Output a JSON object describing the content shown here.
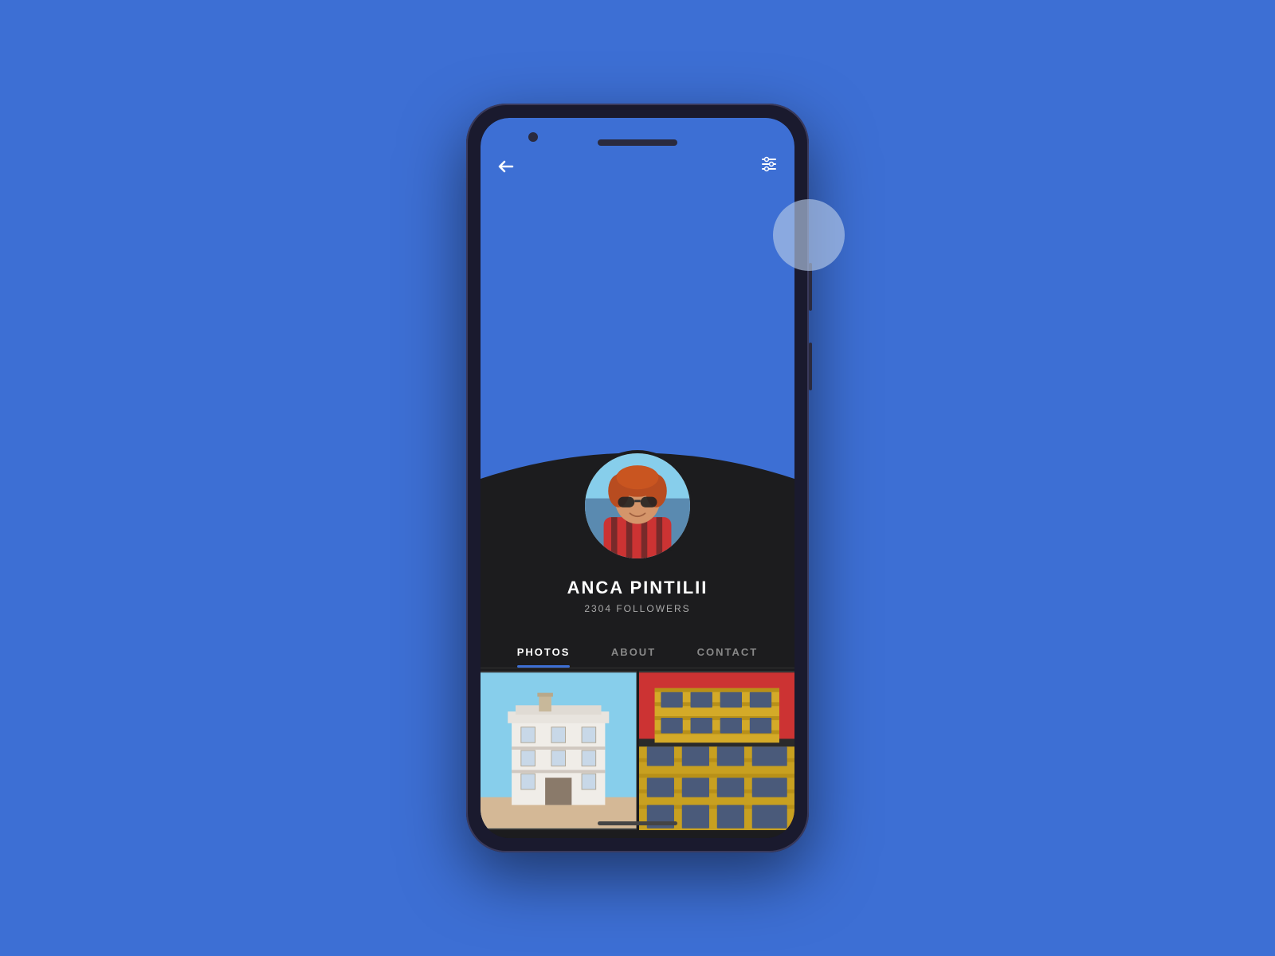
{
  "background_color": "#3d6fd4",
  "phone": {
    "frame_color": "#1a1a2e",
    "screen_bg": "#1c1c1e"
  },
  "header": {
    "back_label": "←",
    "back_icon": "back-arrow-icon",
    "settings_icon": "settings-sliders-icon",
    "header_bg": "#3d6fd4"
  },
  "profile": {
    "name": "ANCA PINTILII",
    "followers_count": "2304",
    "followers_label": "2304 FOLLOWERS",
    "avatar_alt": "profile photo of woman with red hair and sunglasses"
  },
  "tabs": [
    {
      "id": "photos",
      "label": "PHOTOS",
      "active": true
    },
    {
      "id": "about",
      "label": "ABOUT",
      "active": false
    },
    {
      "id": "contact",
      "label": "CONTACT",
      "active": false
    }
  ],
  "photos": [
    {
      "id": "photo1",
      "alt": "white classical building against blue sky",
      "type": "classical_building"
    },
    {
      "id": "photo2",
      "alt": "modern yellow building with red background",
      "type": "modern_building"
    }
  ]
}
